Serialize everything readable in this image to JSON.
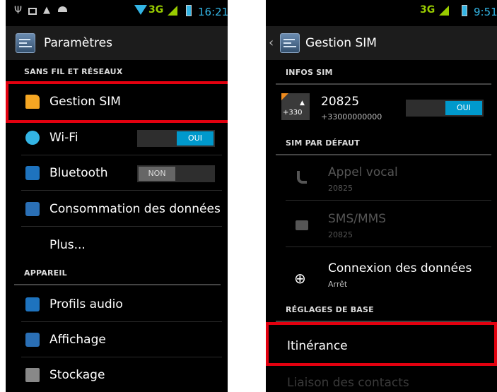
{
  "left": {
    "status": {
      "time": "16:21",
      "network": "3G"
    },
    "title": "Paramètres",
    "sections": {
      "wireless": "SANS FIL ET RÉSEAUX",
      "device": "APPAREIL"
    },
    "items": {
      "sim": "Gestion SIM",
      "wifi": "Wi-Fi",
      "wifi_toggle": "OUI",
      "bluetooth": "Bluetooth",
      "bluetooth_toggle": "NON",
      "data_usage": "Consommation des données",
      "more": "Plus...",
      "audio": "Profils audio",
      "display": "Affichage",
      "storage": "Stockage"
    }
  },
  "right": {
    "status": {
      "time": "9:51",
      "network": "3G"
    },
    "title": "Gestion SIM",
    "sections": {
      "sim_info": "INFOS SIM",
      "default_sim": "SIM PAR DÉFAUT",
      "basic": "RÉGLAGES DE BASE"
    },
    "sim": {
      "badge": "+330",
      "name": "20825",
      "number": "+33000000000",
      "toggle": "OUI"
    },
    "voice": {
      "title": "Appel vocal",
      "sub": "20825"
    },
    "sms": {
      "title": "SMS/MMS",
      "sub": "20825"
    },
    "data": {
      "title": "Connexion des données",
      "sub": "Arrêt"
    },
    "roaming": "Itinérance",
    "contacts": "Liaison des contacts"
  },
  "colors": {
    "accent": "#33b5e5",
    "highlight": "#e3000f",
    "signal": "#99cc00"
  }
}
